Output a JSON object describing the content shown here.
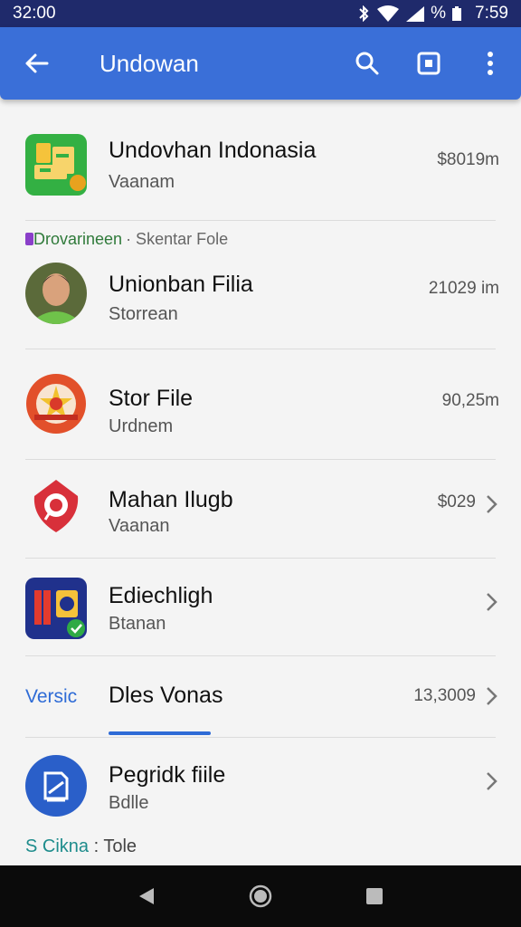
{
  "status_bar": {
    "time_left": "32:00",
    "battery_text": "%",
    "time_right": "7:59"
  },
  "app_bar": {
    "title": "Undowan"
  },
  "items": [
    {
      "name": "Undovhan Indonasia",
      "sub": "Vaanam",
      "size": "$8019m",
      "icon": "folder-app-icon"
    },
    {
      "name": "Unionban Filia",
      "sub": "Storrean",
      "size": "21029 im",
      "icon": "profile-avatar"
    },
    {
      "name": "Stor File",
      "sub": "Urdnem",
      "size": "90,25m",
      "icon": "star-badge-icon"
    },
    {
      "name": "Mahan Ilugb",
      "sub": "Vaanan",
      "size": "$029",
      "icon": "location-pin-icon"
    },
    {
      "name": "Ediechligh",
      "sub": "Btanan",
      "size": "",
      "icon": "media-app-icon"
    },
    {
      "name": "Dles Vonas",
      "sub": "",
      "size": "13,3009",
      "icon": "",
      "left_label": "Versic"
    },
    {
      "name": "Pegridk fiile",
      "sub": "Bdlle",
      "size": "",
      "icon": "edit-document-icon"
    }
  ],
  "section_header": {
    "prefix": "Drovarineen",
    "suffix": "· Skentar Fole"
  },
  "footer_label": {
    "accent": "S Cikna",
    "rest": " : Tole"
  },
  "colors": {
    "app_bar": "#3a6fd8",
    "status_bar": "#1f2a6b",
    "accent_blue": "#2e6bd6",
    "green": "#2f9e44"
  }
}
